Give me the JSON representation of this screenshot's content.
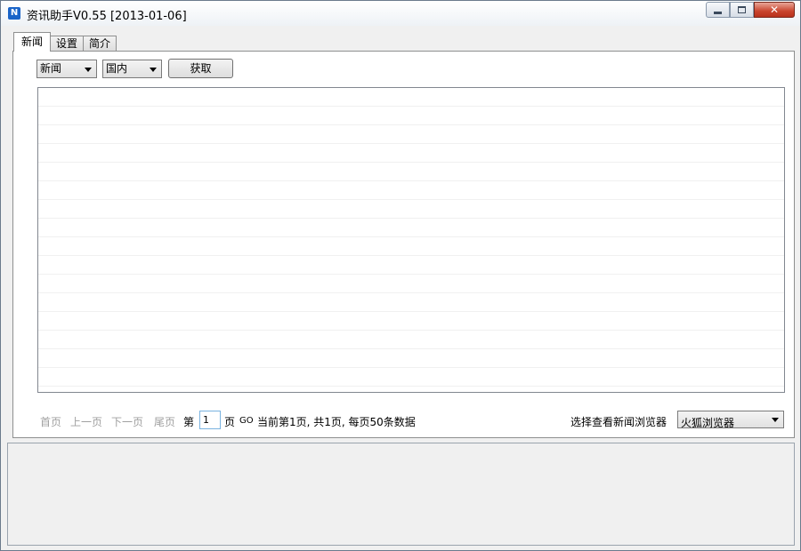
{
  "window": {
    "title": "资讯助手V0.55 [2013-01-06]",
    "icon_letter": "N",
    "min_icon": "minimize-icon",
    "max_icon": "maximize-icon",
    "close_icon": "close-icon",
    "close_glyph": "✕"
  },
  "tabs": [
    {
      "label": "新闻",
      "active": true
    },
    {
      "label": "设置",
      "active": false
    },
    {
      "label": "简介",
      "active": false
    }
  ],
  "toolbar": {
    "category_value": "新闻",
    "region_value": "国内",
    "fetch_label": "获取"
  },
  "list": {
    "rows_visible": 16
  },
  "pager": {
    "first": "首页",
    "prev": "上一页",
    "next": "下一页",
    "last": "尾页",
    "page_prefix": "第",
    "page_value": "1",
    "page_suffix": "页",
    "go": "GO",
    "info": "当前第1页, 共1页, 每页50条数据",
    "browser_label": "选择查看新闻浏览器",
    "browser_value": "火狐浏览器"
  },
  "colors": {
    "close_button": "#c9442d",
    "app_icon": "#1a64c8"
  }
}
